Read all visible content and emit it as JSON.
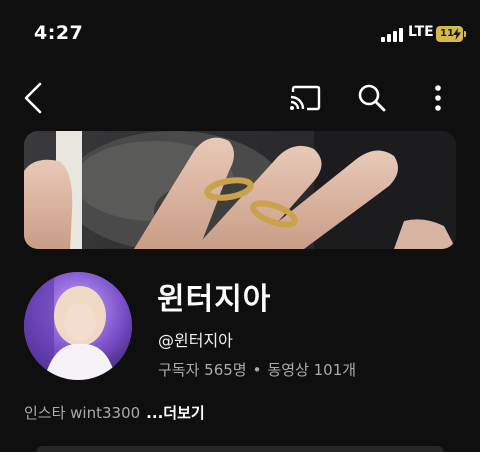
{
  "status": {
    "time": "4:27",
    "network": "LTE",
    "battery_level": "11"
  },
  "toolbar": {
    "back_icon": "back-arrow-icon",
    "cast_icon": "cast-icon",
    "search_icon": "search-icon",
    "more_icon": "more-vertical-icon"
  },
  "channel": {
    "name": "윈터지아",
    "handle": "@윈터지아",
    "subscribers": "구독자 565명",
    "separator": "•",
    "videos": "동영상 101개",
    "description": "인스타 wint3300",
    "more_label": "...더보기"
  },
  "colors": {
    "background": "#0f0f0f",
    "secondary_text": "#aaaaaa",
    "battery": "#d6b94c"
  }
}
